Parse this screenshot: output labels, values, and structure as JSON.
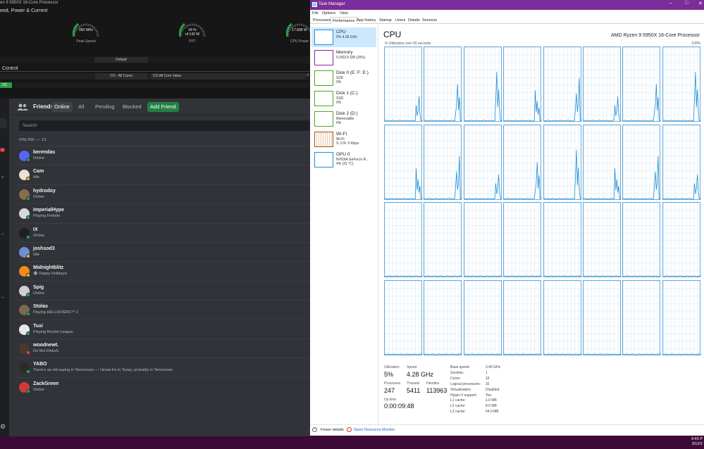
{
  "ryzen": {
    "title": "en 9 5950X 16-Core Processor",
    "section": "eed, Power & Current",
    "gauges": [
      {
        "value": "950  MHz",
        "label": "Peak Speed"
      },
      {
        "value": "34 %\nof 142 W",
        "label": "PPT"
      },
      {
        "value": "17.838 W",
        "label": "CPU Power"
      }
    ],
    "default_label": "Default",
    "control_label": "Control",
    "co_all_cores": "CO - All Cores",
    "co_value": "CO All Core Value",
    "co_dash": "-2",
    "oc": "OC"
  },
  "discord": {
    "friends_title": "Friends",
    "tabs": [
      "Online",
      "All",
      "Pending",
      "Blocked"
    ],
    "add_friend": "Add Friend",
    "search_placeholder": "Search",
    "online_count": "ONLINE — 13",
    "colors": {
      "online": "#23a55a",
      "idle": "#f0b232",
      "dnd": "#f23f43"
    },
    "friends": [
      {
        "name": "berendas",
        "status": "Online",
        "state": "online",
        "avatar": "#5865f2"
      },
      {
        "name": "Cam",
        "status": "Idle",
        "state": "idle",
        "avatar": "#e9e2d4"
      },
      {
        "name": "hydrodoy",
        "status": "Online",
        "state": "online",
        "avatar": "#8c6a4a"
      },
      {
        "name": "ImperialHype",
        "status": "Playing Fortnite",
        "state": "online",
        "avatar": "#d8d8d8"
      },
      {
        "name": "IX",
        "status": "Online",
        "state": "online",
        "avatar": "#202020"
      },
      {
        "name": "joshsod3",
        "status": "Idle",
        "state": "idle",
        "avatar": "#6d8fd4"
      },
      {
        "name": "Midnightblitz",
        "status": "❄️ Happy Holidays!",
        "state": "idle",
        "avatar": "#f28a1c"
      },
      {
        "name": "Spig",
        "status": "Online",
        "state": "online",
        "avatar": "#cfcfcf"
      },
      {
        "name": "Stolas",
        "status": "Playing HELLDIVERS™ 2",
        "state": "online",
        "avatar": "#7a6a50"
      },
      {
        "name": "Tuxi",
        "status": "Playing Rocket League",
        "state": "online",
        "avatar": "#e8e8e8"
      },
      {
        "name": "woodnewt.",
        "status": "Do Not Disturb",
        "state": "dnd",
        "avatar": "#4a3a2e"
      },
      {
        "name": "YABO",
        "status": "There's an old saying in Tennessee — I know it's in Texas, probably in Tennessee",
        "state": "online",
        "avatar": "#2b2b2b"
      },
      {
        "name": "ZackGreen",
        "status": "Online",
        "state": "online",
        "avatar": "#d23a3a"
      }
    ]
  },
  "taskmanager": {
    "title": "Task Manager",
    "menu": [
      "File",
      "Options",
      "View"
    ],
    "tabs": [
      "Processes",
      "Performance",
      "App history",
      "Startup",
      "Users",
      "Details",
      "Services"
    ],
    "active_tab": "Performance",
    "sidebar": [
      {
        "name": "CPU",
        "l1": "5% 4.28 GHz",
        "l2": "",
        "color": "#1c8fd7"
      },
      {
        "name": "Memory",
        "l1": "9.3/63.9 GB (15%)",
        "l2": "",
        "color": "#8b22a8"
      },
      {
        "name": "Disk 0 (E: F: E:)",
        "l1": "SSD",
        "l2": "0%",
        "color": "#4da71c"
      },
      {
        "name": "Disk 1 (C:)",
        "l1": "SSD",
        "l2": "0%",
        "color": "#4da71c"
      },
      {
        "name": "Disk 2 (D:)",
        "l1": "Removable",
        "l2": "0%",
        "color": "#4da71c"
      },
      {
        "name": "Wi-Fi",
        "l1": "Wi-Fi",
        "l2": "S: 0  R: 0 Kbps",
        "color": "#a7560e"
      },
      {
        "name": "GPU 0",
        "l1": "NVIDIA GeForce R...",
        "l2": "4% (31 °C)",
        "color": "#1c8fd7"
      }
    ],
    "cpu_heading": "CPU",
    "processor": "AMD Ryzen 9 5950X 16-Core Processor",
    "util_label": "% Utilization over 60 seconds",
    "util_max": "100%",
    "stats": {
      "utilization_label": "Utilization",
      "utilization": "5%",
      "speed_label": "Speed",
      "speed": "4.28 GHz",
      "processes_label": "Processes",
      "processes": "247",
      "threads_label": "Threads",
      "threads": "5411",
      "handles_label": "Handles",
      "handles": "113963",
      "uptime_label": "Up time",
      "uptime": "0:00:09:48"
    },
    "specs": [
      [
        "Base speed:",
        "3.40 GHz"
      ],
      [
        "Sockets:",
        "1"
      ],
      [
        "Cores:",
        "16"
      ],
      [
        "Logical processors:",
        "32"
      ],
      [
        "Virtualization:",
        "Disabled"
      ],
      [
        "Hyper-V support:",
        "Yes"
      ],
      [
        "L1 cache:",
        "1.0 MB"
      ],
      [
        "L2 cache:",
        "8.0 MB"
      ],
      [
        "L3 cache:",
        "64.0 MB"
      ]
    ],
    "fewer_details": "Fewer details",
    "resource_monitor": "Open Resource Monitor",
    "time": "9:40 P",
    "date": "3/12/2"
  }
}
